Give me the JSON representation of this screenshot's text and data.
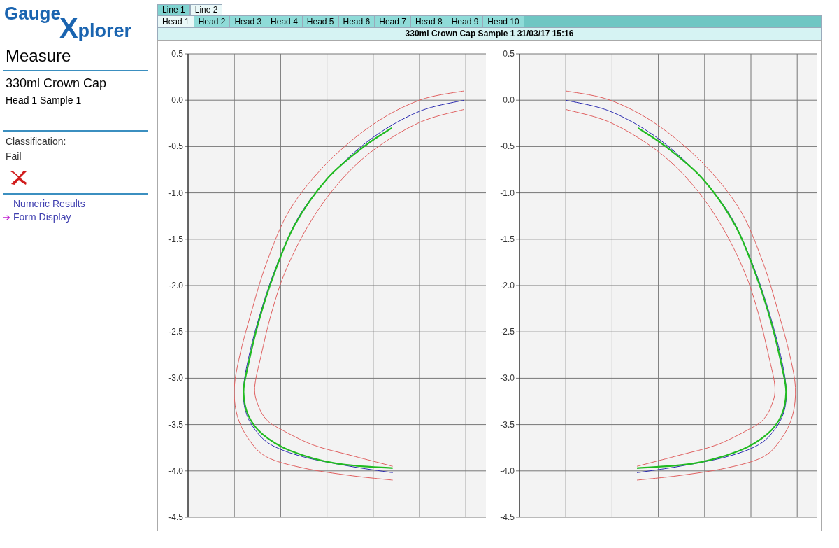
{
  "logo": {
    "part_1": "Gauge",
    "part_2": "X",
    "part_3": "plorer"
  },
  "sidebar": {
    "heading": "Measure",
    "product": "330ml Crown Cap",
    "sample": "Head 1 Sample 1",
    "classification_label": "Classification:",
    "classification": "Fail",
    "passed": false,
    "nav": [
      {
        "label": "Numeric Results",
        "selected": false
      },
      {
        "label": "Form Display",
        "selected": true
      }
    ],
    "selected_marker": "➔"
  },
  "line_tabs": [
    {
      "label": "Line 1",
      "selected": false
    },
    {
      "label": "Line 2",
      "selected": true
    }
  ],
  "head_tabs": [
    {
      "label": "Head 1",
      "selected": true
    },
    {
      "label": "Head 2",
      "selected": false
    },
    {
      "label": "Head 3",
      "selected": false
    },
    {
      "label": "Head 4",
      "selected": false
    },
    {
      "label": "Head 5",
      "selected": false
    },
    {
      "label": "Head 6",
      "selected": false
    },
    {
      "label": "Head 7",
      "selected": false
    },
    {
      "label": "Head 8",
      "selected": false
    },
    {
      "label": "Head 9",
      "selected": false
    },
    {
      "label": "Head 10",
      "selected": false
    }
  ],
  "panel_title": "330ml Crown Cap Sample 1 31/03/17 15:16",
  "charts": [
    {
      "kind": "left",
      "y_axis_labels": [
        "0.5",
        "0.0",
        "-0.5",
        "-1.0",
        "-1.5",
        "-2.0",
        "-2.5",
        "-3.0",
        "-3.5",
        "-4.0",
        "-4.5"
      ]
    },
    {
      "kind": "right",
      "y_axis_labels": [
        "0.5",
        "0.0",
        "-0.5",
        "-1.0",
        "-1.5",
        "-2.0",
        "-2.5",
        "-3.0",
        "-3.5",
        "-4.0",
        "-4.5"
      ]
    }
  ]
}
